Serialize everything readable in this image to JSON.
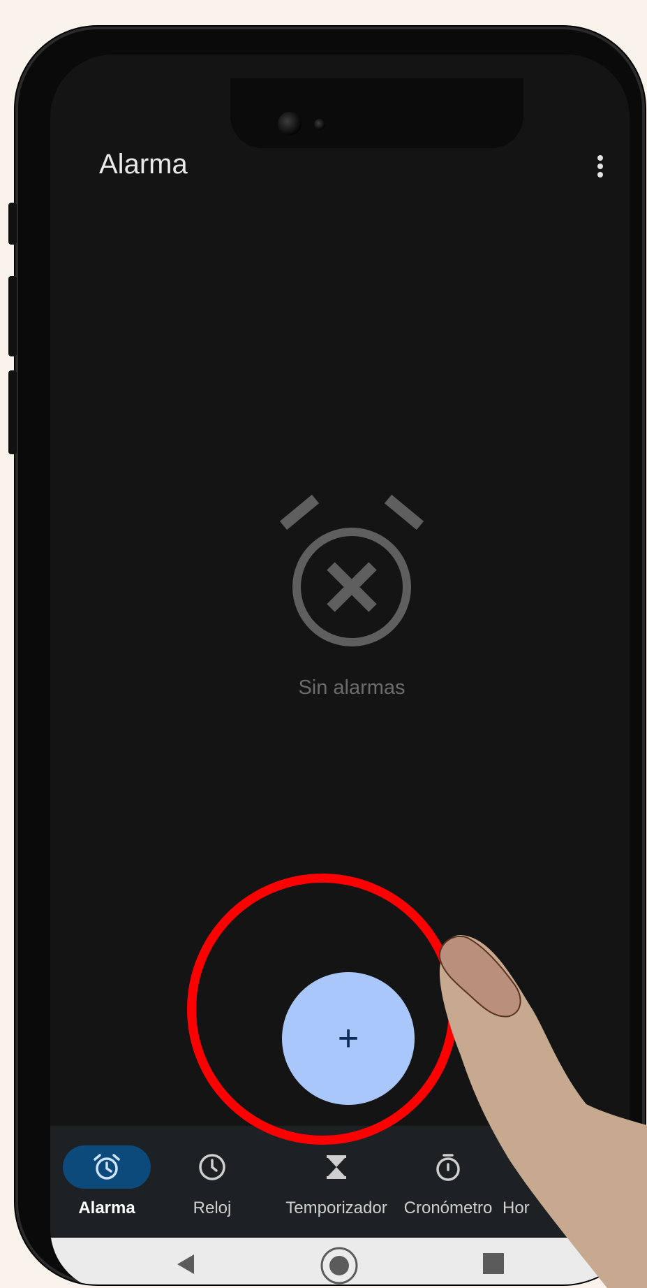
{
  "header": {
    "title": "Alarma"
  },
  "empty_state": {
    "message": "Sin alarmas"
  },
  "fab": {
    "label": "+"
  },
  "nav": {
    "items": [
      {
        "label": "Alarma",
        "icon": "alarm-clock-icon",
        "active": true
      },
      {
        "label": "Reloj",
        "icon": "clock-icon",
        "active": false
      },
      {
        "label": "Temporizador",
        "icon": "hourglass-icon",
        "active": false
      },
      {
        "label": "Cronómetro",
        "icon": "stopwatch-icon",
        "active": false
      },
      {
        "label": "Hor",
        "icon": "bedtime-icon",
        "active": false
      }
    ]
  },
  "colors": {
    "background": "#141414",
    "accent": "#a9c7fb",
    "active_tab": "#0b4a7a",
    "highlight_ring": "#ff0000"
  }
}
